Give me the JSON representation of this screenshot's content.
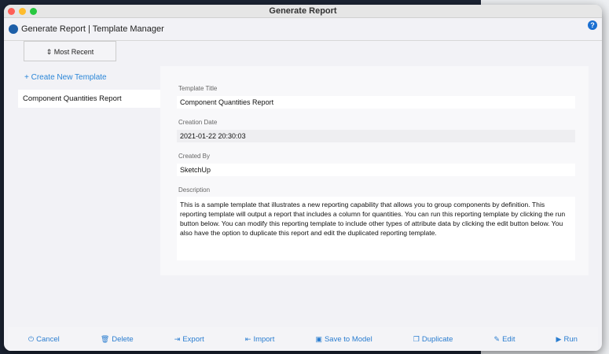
{
  "window": {
    "title": "Generate Report"
  },
  "header": {
    "title": "Generate Report | Template Manager",
    "help": "?"
  },
  "sidebar": {
    "sort_label": "⇕ Most Recent",
    "create_label": "+ Create New Template",
    "items": [
      {
        "label": "Component Quantities Report"
      }
    ]
  },
  "form": {
    "title_label": "Template Title",
    "title_value": "Component Quantities Report",
    "date_label": "Creation Date",
    "date_value": "2021-01-22 20:30:03",
    "author_label": "Created By",
    "author_value": "SketchUp",
    "desc_label": "Description",
    "desc_value": "This is a sample template that illustrates a new reporting capability that allows you to group components by definition. This reporting template will output a report that includes a column for quantities. You can run this reporting template by clicking the run button below. You can modify this reporting template to include other types of attribute data by clicking the edit button below. You also have the option to duplicate this report and edit the duplicated reporting template."
  },
  "footer": {
    "buttons": [
      {
        "label": "Cancel",
        "icon": "⏻"
      },
      {
        "label": "Delete",
        "icon": "🗑"
      },
      {
        "label": "Export",
        "icon": "⇥"
      },
      {
        "label": "Import",
        "icon": "⇤"
      },
      {
        "label": "Save to Model",
        "icon": "▣"
      },
      {
        "label": "Duplicate",
        "icon": "❐"
      },
      {
        "label": "Edit",
        "icon": "✎"
      },
      {
        "label": "Run",
        "icon": "▶"
      }
    ]
  },
  "colors": {
    "accent": "#2a7dd0"
  }
}
